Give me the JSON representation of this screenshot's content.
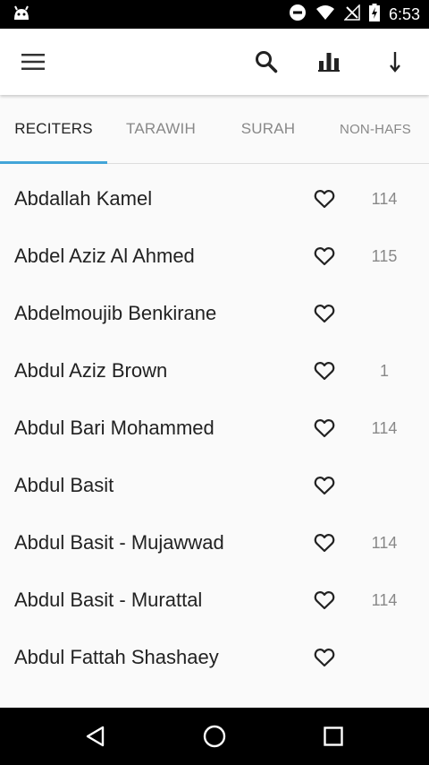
{
  "status_bar": {
    "time": "6:53",
    "icons": [
      "android-icon",
      "do-not-disturb-icon",
      "wifi-icon",
      "no-signal-icon",
      "battery-charging-icon"
    ]
  },
  "toolbar": {
    "icons": [
      "menu-icon",
      "search-icon",
      "bar-chart-icon",
      "sort-icon"
    ]
  },
  "tabs": [
    {
      "label": "RECITERS",
      "active": true
    },
    {
      "label": "TARAWIH",
      "active": false
    },
    {
      "label": "SURAH",
      "active": false
    },
    {
      "label": "NON-HAFS",
      "active": false
    }
  ],
  "accent_color": "#42a5d8",
  "reciters": [
    {
      "name": "Abdallah Kamel",
      "count": "114"
    },
    {
      "name": "Abdel Aziz Al Ahmed",
      "count": "115"
    },
    {
      "name": "Abdelmoujib Benkirane",
      "count": ""
    },
    {
      "name": "Abdul Aziz Brown",
      "count": "1"
    },
    {
      "name": "Abdul Bari Mohammed",
      "count": "114"
    },
    {
      "name": "Abdul Basit",
      "count": ""
    },
    {
      "name": "Abdul Basit - Mujawwad",
      "count": "114"
    },
    {
      "name": "Abdul Basit - Murattal",
      "count": "114"
    },
    {
      "name": "Abdul Fattah Shashaey",
      "count": ""
    }
  ],
  "nav_bar": {
    "icons": [
      "back-icon",
      "home-icon",
      "recents-icon"
    ]
  }
}
